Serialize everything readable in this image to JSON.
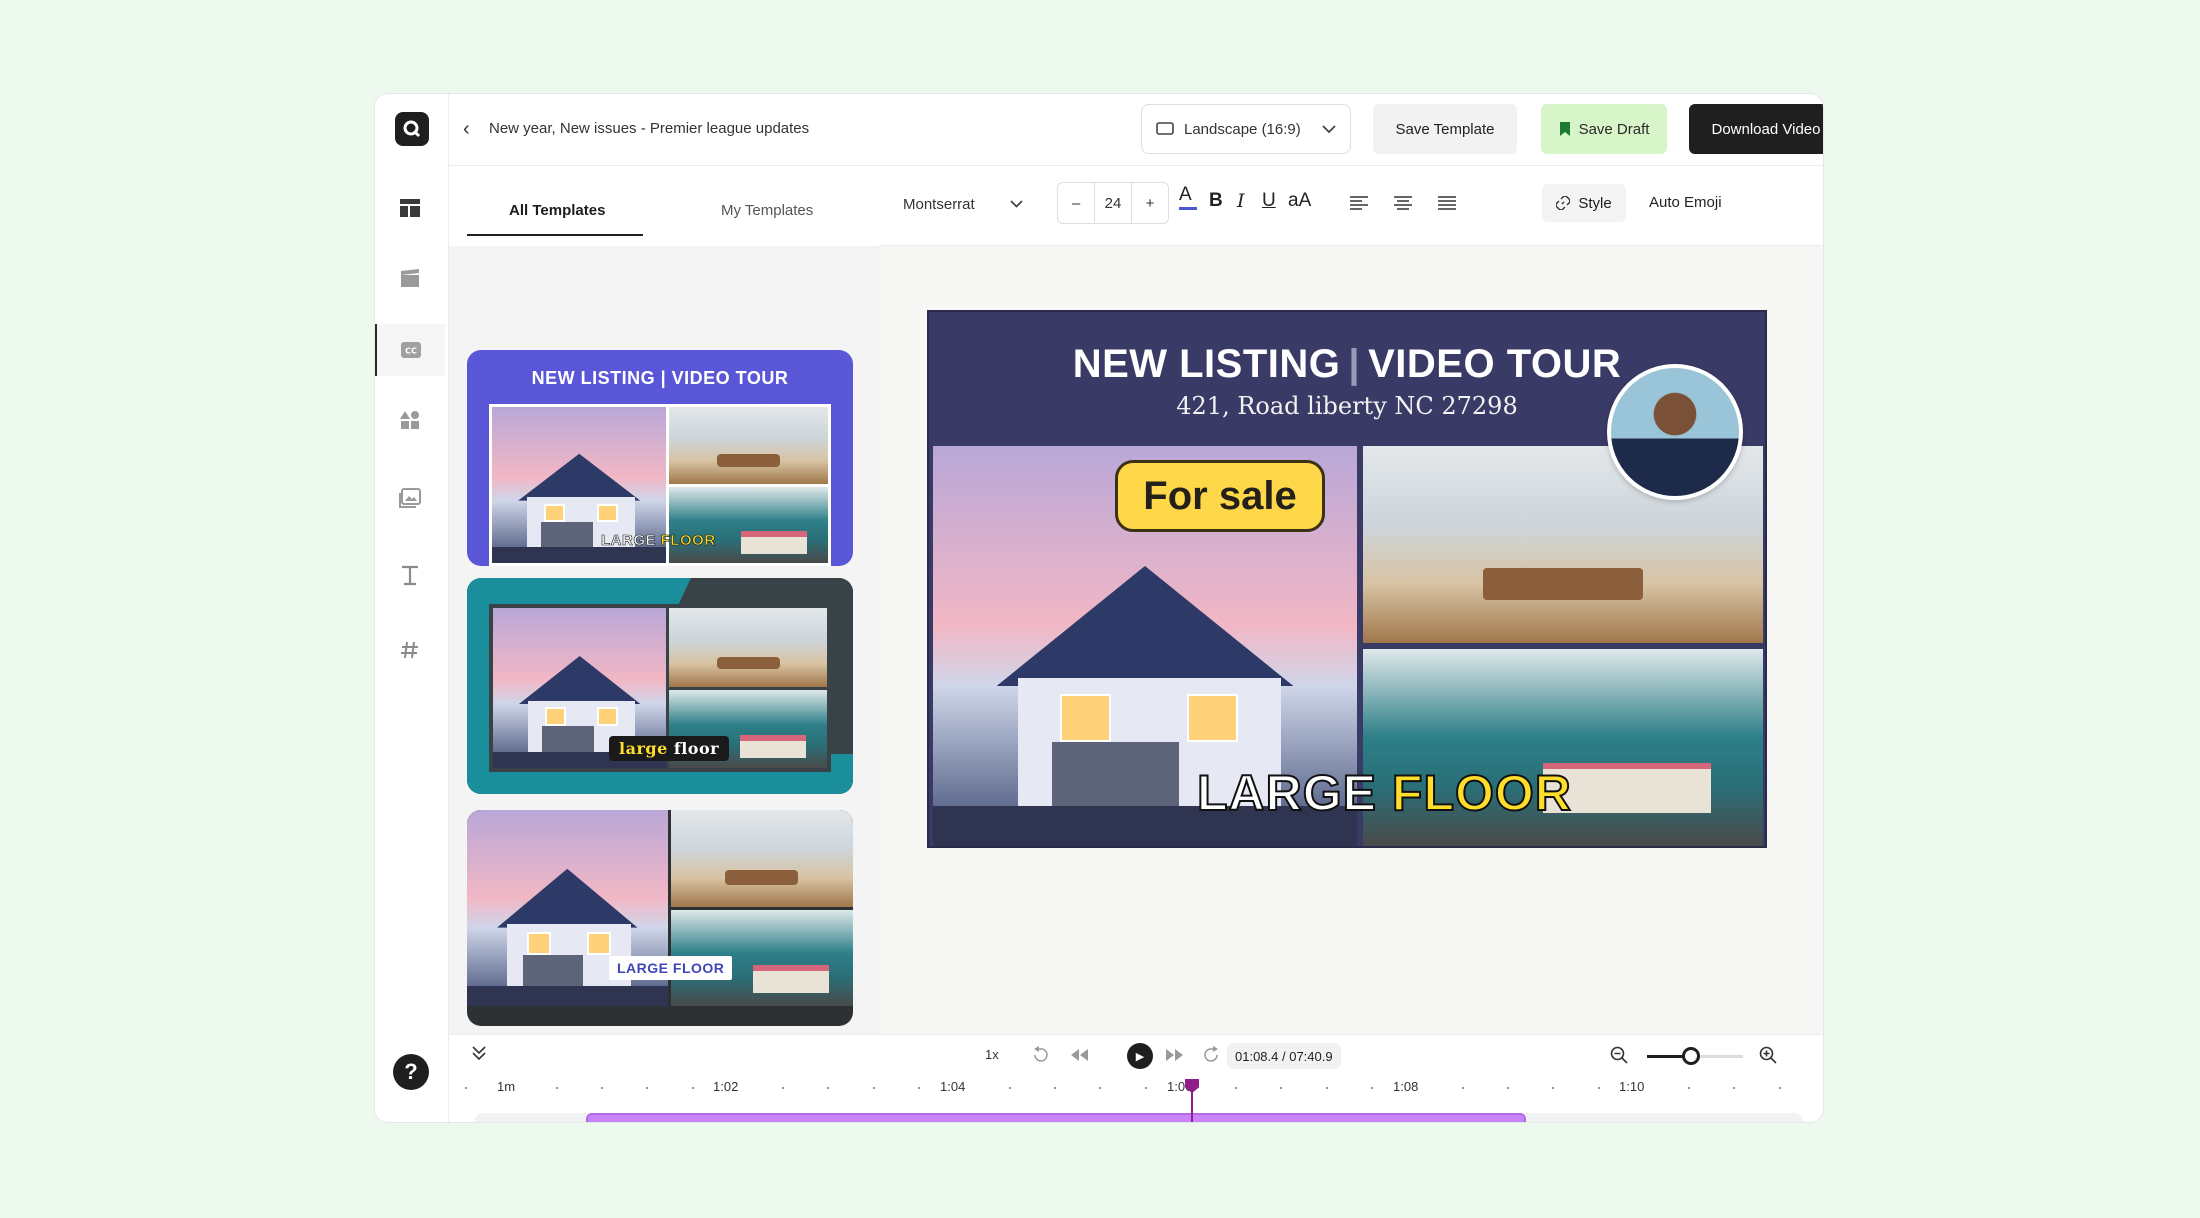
{
  "header": {
    "title": "New year, New issues - Premier league updates",
    "aspect": "Landscape (16:9)",
    "save_template": "Save Template",
    "save_draft": "Save Draft",
    "download": "Download Video"
  },
  "panel": {
    "tabs": [
      "All Templates",
      "My Templates"
    ],
    "cards": [
      {
        "title": "NEW LISTING | VIDEO TOUR",
        "caption_a": "LARGE",
        "caption_b": "FLOOR"
      },
      {
        "caption_a": "large",
        "caption_b": "floor"
      },
      {
        "caption_a": "LARGE FLOOR"
      }
    ]
  },
  "toolbar": {
    "font": "Montserrat",
    "size_minus": "–",
    "size": "24",
    "size_plus": "+",
    "text_color_glyph": "A",
    "bold": "B",
    "italic": "I",
    "underline": "U",
    "case": "aA",
    "style": "Style",
    "auto_emoji": "Auto Emoji"
  },
  "poster": {
    "title_a": "NEW LISTING",
    "title_sep": "|",
    "title_b": "VIDEO TOUR",
    "address": "421, Road liberty NC 27298",
    "badge": "For sale",
    "caption_a": "LARGE",
    "caption_b": "FLOOR"
  },
  "timeline": {
    "speed": "1x",
    "time": "01:08.4 / 07:40.9",
    "ticks": [
      "1m",
      "1:02",
      "1:04",
      "1:06",
      "1:08",
      "1:10"
    ],
    "zoom_level": 0.46
  },
  "colors": {
    "accent_green": "#d8f5c9",
    "dark": "#1f1f1f",
    "clip_purple": "#c983fb",
    "playhead": "#8f1e8a",
    "poster_bg": "#3a3a66",
    "badge_yellow": "#ffd84a"
  },
  "icons": [
    "logo-icon",
    "layout-icon",
    "clapper-icon",
    "cc-icon",
    "elements-icon",
    "image-icon",
    "text-icon",
    "hashtag-icon",
    "help-icon",
    "monitor-icon",
    "bookmark-icon",
    "chevron-left-icon",
    "chevron-down-icon",
    "link-icon",
    "align-left-icon",
    "align-center-icon",
    "align-justify-icon",
    "collapse-icon",
    "rewind-5-icon",
    "skip-back-icon",
    "play-icon",
    "skip-forward-icon",
    "forward-5-icon",
    "zoom-out-icon",
    "zoom-in-icon"
  ]
}
